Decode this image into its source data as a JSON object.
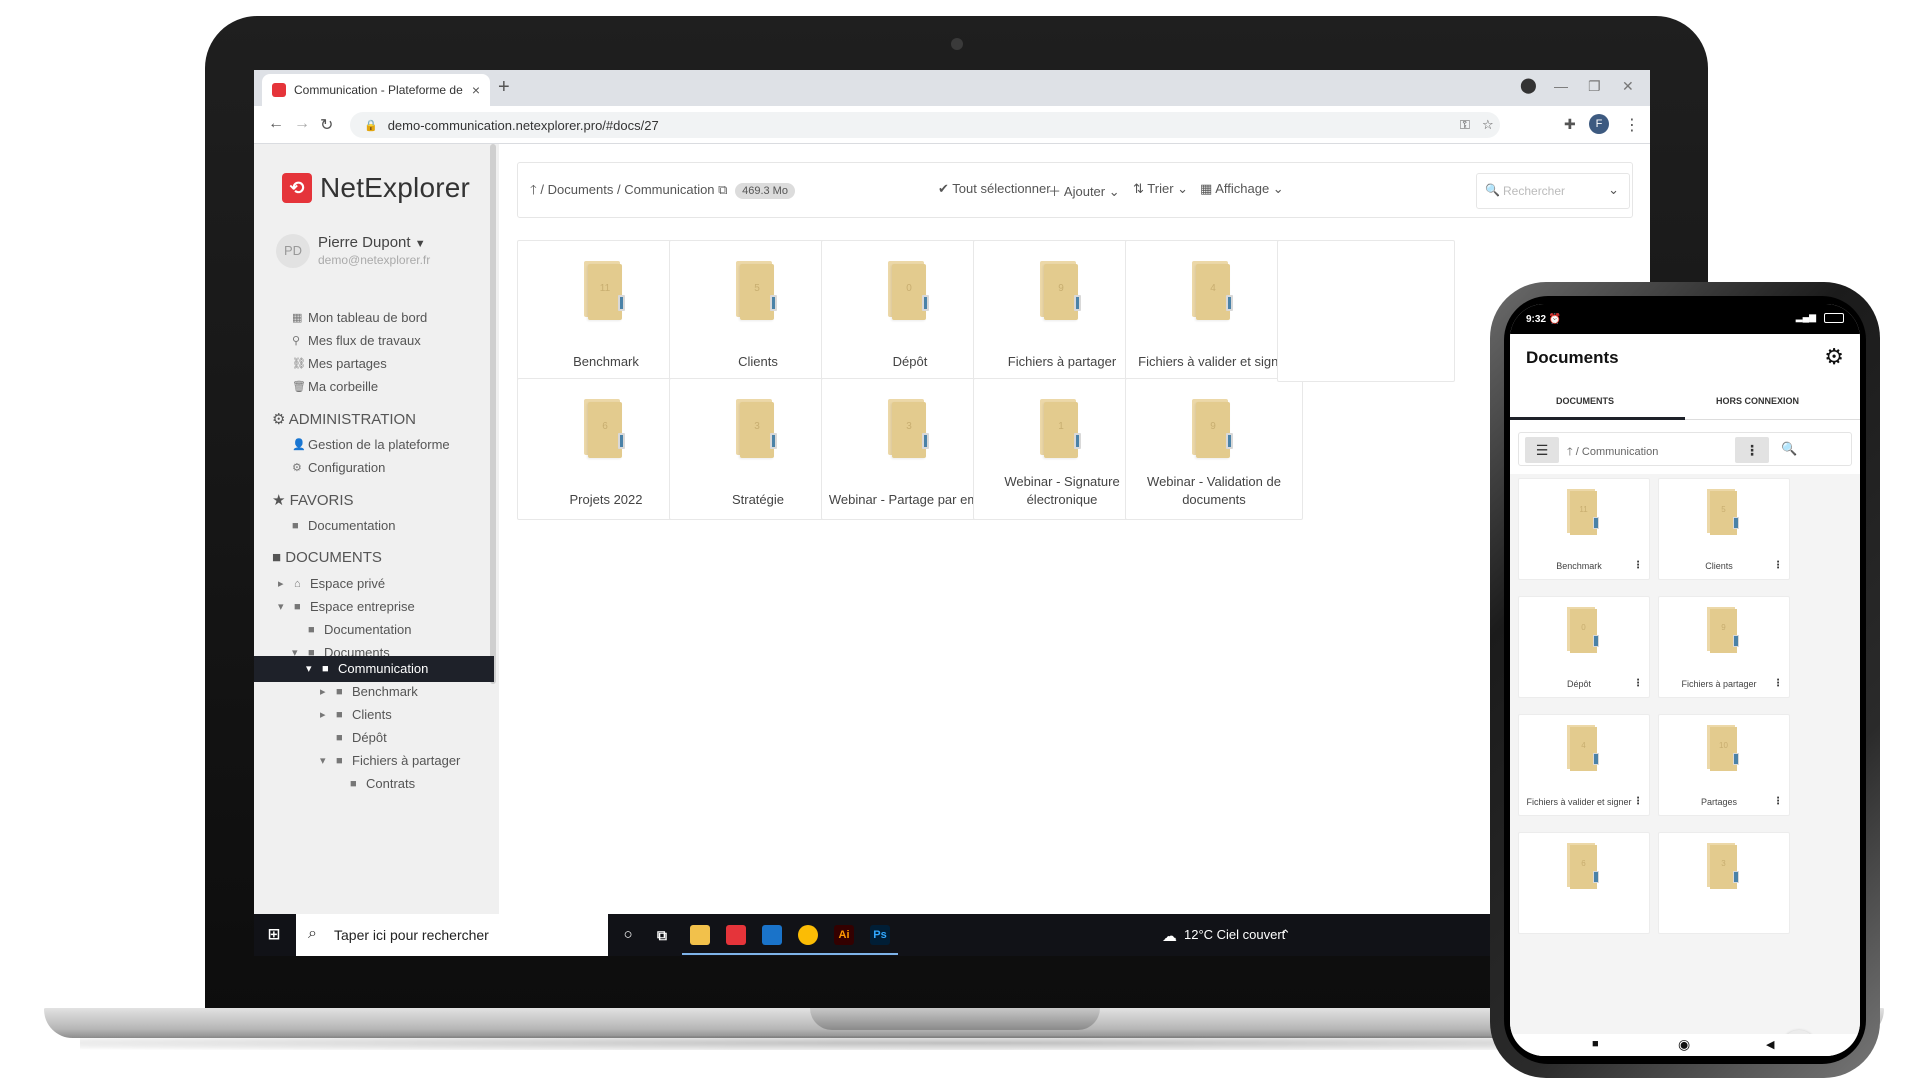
{
  "browser": {
    "tab_title": "Communication - Plateforme de",
    "tab_close": "×",
    "new_tab": "+",
    "url": "demo-communication.netexplorer.pro/#docs/27",
    "profile_initial": "F"
  },
  "app": {
    "logo_mark": "⟲",
    "logo_text": "NetExplorer",
    "user": {
      "initials": "PD",
      "name": "Pierre Dupont",
      "email": "demo@netexplorer.fr"
    },
    "nav": [
      {
        "icon": "▦",
        "label": "Mon tableau de bord"
      },
      {
        "icon": "⚲",
        "label": "Mes flux de travaux"
      },
      {
        "icon": "⛓",
        "label": "Mes partages"
      },
      {
        "icon": "🗑",
        "label": "Ma corbeille"
      }
    ],
    "admin": {
      "header": "ADMINISTRATION",
      "items": [
        "Gestion de la plateforme",
        "Configuration"
      ]
    },
    "favoris": {
      "header": "FAVORIS",
      "items": [
        "Documentation"
      ]
    },
    "documents": {
      "header": "DOCUMENTS",
      "tree": [
        "Espace privé",
        "Espace entreprise",
        "Documentation",
        "Documents",
        "Communication",
        "Benchmark",
        "Clients",
        "Dépôt",
        "Fichiers à partager",
        "Contrats"
      ]
    },
    "toolbar": {
      "crumb_root": "/ Documents",
      "crumb_current": "/ Communication",
      "size": "469.3 Mo",
      "select_all": "Tout sélectionner",
      "add": "Ajouter",
      "sort": "Trier",
      "view": "Affichage",
      "search_placeholder": "Rechercher"
    },
    "folders": [
      {
        "name": "Benchmark",
        "count": "11"
      },
      {
        "name": "Clients",
        "count": "5"
      },
      {
        "name": "Dépôt",
        "count": "0"
      },
      {
        "name": "Fichiers à partager",
        "count": "9"
      },
      {
        "name": "Fichiers à valider et signer",
        "count": "4"
      },
      {
        "name": "Projets 2022",
        "count": "6"
      },
      {
        "name": "Stratégie",
        "count": "3"
      },
      {
        "name": "Webinar - Partage par email",
        "count": "3"
      },
      {
        "name": "Webinar - Signature électronique",
        "count": "1"
      },
      {
        "name": "Webinar - Validation de documents",
        "count": "9"
      }
    ]
  },
  "taskbar": {
    "search_placeholder": "Taper ici pour rechercher",
    "weather": "12°C  Ciel couvert",
    "ai_label": "Ai",
    "ps_label": "Ps"
  },
  "phone": {
    "time": "9:32",
    "title": "Documents",
    "tab_documents": "DOCUMENTS",
    "tab_offline": "HORS CONNEXION",
    "crumb": "/ Communication",
    "folders": [
      {
        "name": "Benchmark",
        "count": "11"
      },
      {
        "name": "Clients",
        "count": "5"
      },
      {
        "name": "Dépôt",
        "count": "0"
      },
      {
        "name": "Fichiers à partager",
        "count": "9"
      },
      {
        "name": "Fichiers à valider et signer",
        "count": "4"
      },
      {
        "name": "Partages",
        "count": "10"
      },
      {
        "name": "",
        "count": "6"
      },
      {
        "name": "",
        "count": "3"
      }
    ]
  }
}
